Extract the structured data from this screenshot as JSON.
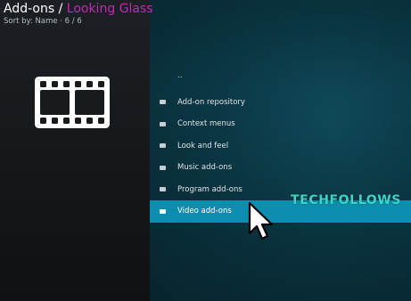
{
  "header": {
    "title_prefix": "Add-ons / ",
    "title_accent": "Looking Glass",
    "sort_text": "Sort by: Name  ·  6 / 6"
  },
  "category_icon": "film-strip-icon",
  "list": {
    "parent_label": "..",
    "items": [
      {
        "label": "Add-on repository",
        "icon": "folder-icon"
      },
      {
        "label": "Context menus",
        "icon": "folder-icon"
      },
      {
        "label": "Look and feel",
        "icon": "folder-icon"
      },
      {
        "label": "Music add-ons",
        "icon": "folder-icon"
      },
      {
        "label": "Program add-ons",
        "icon": "folder-icon"
      },
      {
        "label": "Video add-ons",
        "icon": "folder-icon",
        "selected": true
      }
    ]
  },
  "watermark": "TECHFOLLOWS",
  "colors": {
    "accent": "#c12ab8",
    "selection": "#0c8fae",
    "watermark": "#38d6c8"
  }
}
